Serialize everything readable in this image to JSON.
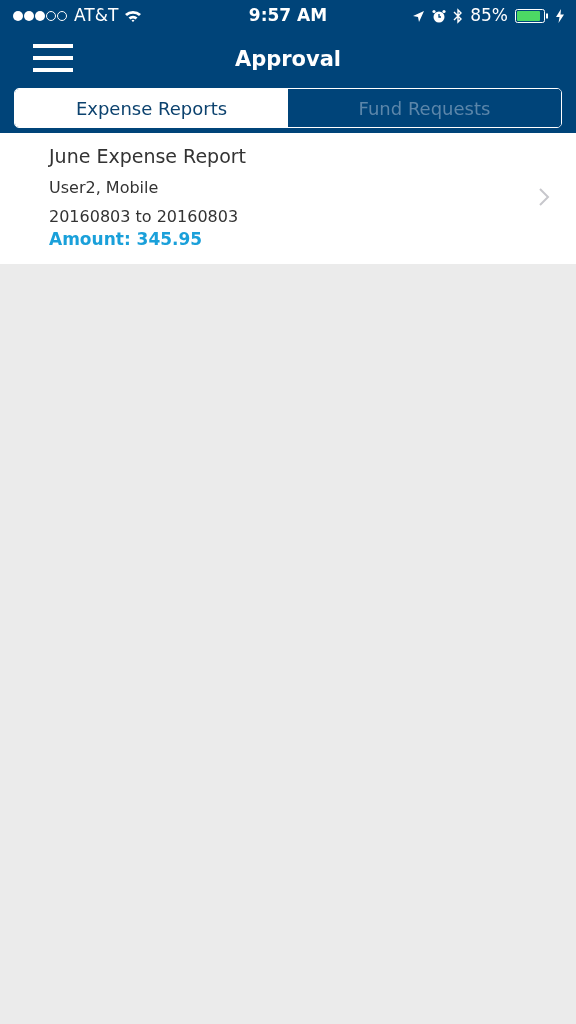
{
  "status_bar": {
    "carrier": "AT&T",
    "time": "9:57 AM",
    "battery": "85%"
  },
  "header": {
    "title": "Approval"
  },
  "tabs": [
    {
      "label": "Expense Reports",
      "selected": true
    },
    {
      "label": "Fund Requests",
      "selected": false
    }
  ],
  "reports": [
    {
      "title": "June Expense Report",
      "submitter": "User2, Mobile",
      "period": "20160803 to 20160803",
      "amount": "Amount: 345.95"
    }
  ]
}
